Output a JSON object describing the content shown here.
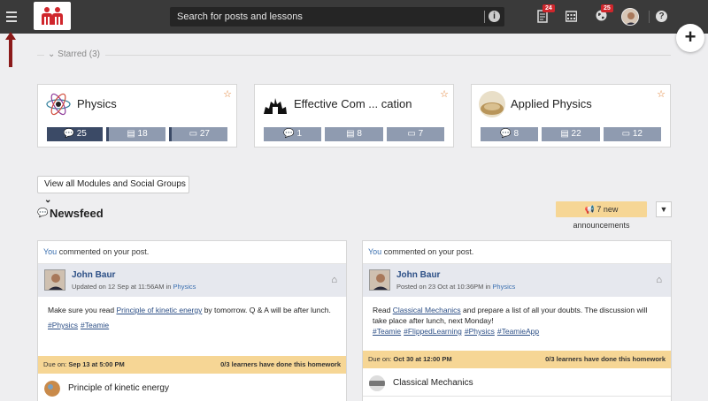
{
  "search": {
    "placeholder": "Search for posts and lessons"
  },
  "topbar": {
    "notifications_badge": "24",
    "globe_badge": "25"
  },
  "starred": {
    "label": "Starred (3)"
  },
  "cards": [
    {
      "title": "Physics",
      "stats": [
        "25",
        "18",
        "27"
      ]
    },
    {
      "title": "Effective Com ... cation",
      "stats": [
        "1",
        "8",
        "7"
      ]
    },
    {
      "title": "Applied Physics",
      "stats": [
        "8",
        "22",
        "12"
      ]
    }
  ],
  "modules_button": "View all Modules and Social Groups",
  "newsfeed": {
    "title": "Newsfeed",
    "announcements": "7 new announcements"
  },
  "posts": [
    {
      "you": "You",
      "activity": " commented on your post.",
      "user": "John Baur",
      "meta": "Updated on 12 Sep at 11:56AM",
      "in_label": " in ",
      "group": "Physics",
      "text_before": "Make sure you read ",
      "link": "Principle of kinetic energy",
      "text_after": "  by tomorrow. Q & A will be after lunch.",
      "tags": [
        "#Physics",
        "#Teamie"
      ],
      "due_label": "Due on: ",
      "due_date": "Sep 13 at 5:00 PM",
      "learners": "0/3 learners have done this homework",
      "attachment": "Principle of kinetic energy"
    },
    {
      "you": "You",
      "activity": " commented on your post.",
      "user": "John Baur",
      "meta": "Posted on 23 Oct at 10:36PM",
      "in_label": " in ",
      "group": "Physics",
      "text_before": "Read ",
      "link": "Classical Mechanics",
      "text_after": " and prepare a list of all your doubts. The discussion will take place after lunch, next Monday!",
      "tags": [
        "#Teamie",
        "#FlippedLearning",
        "#Physics",
        "#TeamieApp"
      ],
      "due_label": "Due on: ",
      "due_date": "Oct 30 at 12:00 PM",
      "learners": "0/3 learners have done this homework",
      "attachment": "Classical Mechanics"
    }
  ]
}
